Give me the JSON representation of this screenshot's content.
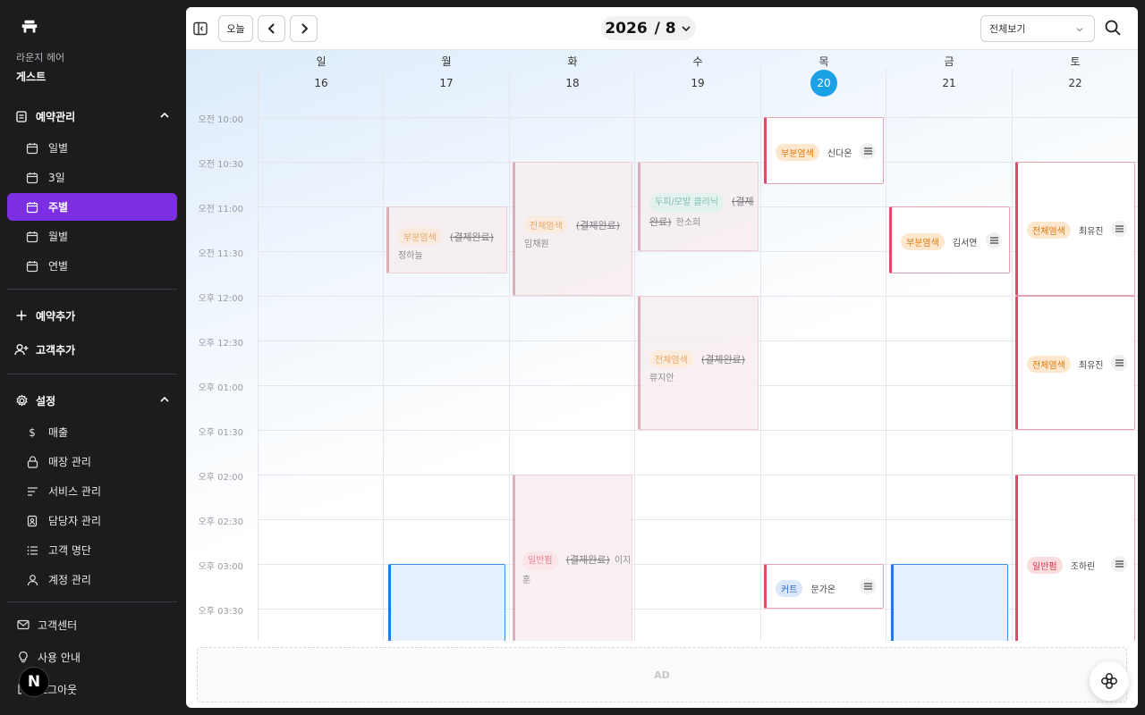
{
  "sidebar": {
    "shop_name": "라운지 헤어",
    "user_name": "게스트",
    "reservation": {
      "label": "예약관리",
      "items": [
        {
          "label": "일별"
        },
        {
          "label": "3일"
        },
        {
          "label": "주별"
        },
        {
          "label": "월별"
        },
        {
          "label": "연별"
        }
      ],
      "active_index": 2
    },
    "add_reservation": "예약추가",
    "add_customer": "고객추가",
    "settings": {
      "label": "설정",
      "items": [
        {
          "label": "매출",
          "icon": "dollar-icon"
        },
        {
          "label": "매장 관리",
          "icon": "lock-icon"
        },
        {
          "label": "서비스 관리",
          "icon": "list-icon"
        },
        {
          "label": "담당자 관리",
          "icon": "badge-icon"
        },
        {
          "label": "고객 명단",
          "icon": "bullets-icon"
        },
        {
          "label": "계정 관리",
          "icon": "user-icon"
        }
      ]
    },
    "customer_center": "고객센터",
    "usage_guide": "사용 안내",
    "logout": "로그아웃",
    "badge_letter": "N"
  },
  "toolbar": {
    "today_label": "오늘",
    "year": "2026",
    "month": "/ 8",
    "view_select": "전체보기"
  },
  "calendar": {
    "days": [
      {
        "name": "일",
        "date": "16"
      },
      {
        "name": "월",
        "date": "17"
      },
      {
        "name": "화",
        "date": "18"
      },
      {
        "name": "수",
        "date": "19"
      },
      {
        "name": "목",
        "date": "20",
        "today": true
      },
      {
        "name": "금",
        "date": "21"
      },
      {
        "name": "토",
        "date": "22"
      }
    ],
    "time_labels": [
      "오전 10:00",
      "오전 10:30",
      "오전 11:00",
      "오전 11:30",
      "오후 12:00",
      "오후 12:30",
      "오후 01:00",
      "오후 01:30",
      "오후 02:00",
      "오후 02:30",
      "오후 03:00",
      "오후 03:30"
    ],
    "paid_label": "(결제완료)",
    "events": {
      "e1": {
        "tag": "부분염색",
        "name": "정하늘"
      },
      "e2": {
        "tag": "전체염색",
        "name": "임채원"
      },
      "e3": {
        "tag": "두피/모발 클리닉",
        "name": "한소희"
      },
      "e4": {
        "tag": "부분염색",
        "name": "신다온"
      },
      "e5": {
        "tag": "부분염색",
        "name": "김서연"
      },
      "e6": {
        "tag": "전체염색",
        "name": "최유진"
      },
      "e7": {
        "tag": "전체염색",
        "name": "류지안"
      },
      "e8": {
        "tag": "전체염색",
        "name": "최유진"
      },
      "e9": {
        "tag": "일반펌",
        "name": "이지훈"
      },
      "e10": {
        "tag": "커트",
        "name": "문가온"
      },
      "e11": {
        "tag": "일반펌",
        "name": "조하린"
      }
    }
  },
  "ad_label": "AD",
  "colors": {
    "accent_purple": "#7b2fe0",
    "today_blue": "#1aa1e6",
    "event_red": "#e04b6a",
    "event_blue": "#1e7be0"
  }
}
